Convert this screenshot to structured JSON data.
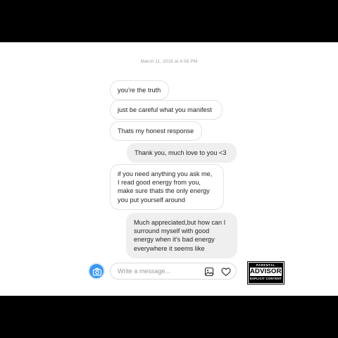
{
  "timestamp": "March 11, 2018 at 4:06 PM",
  "messages": [
    {
      "direction": "incoming",
      "text": "you’re the truth"
    },
    {
      "direction": "incoming",
      "text": "just be careful what you manifest"
    },
    {
      "direction": "incoming",
      "text": "Thats my honest response"
    },
    {
      "direction": "outgoing",
      "text": "Thank you, much love to you <3"
    },
    {
      "direction": "incoming",
      "text": "if you need anything you ask me,\nI read good energy from you,\nmake sure thats the only energy\nyou put yourself around"
    },
    {
      "direction": "outgoing",
      "text": "Much appreciated,but how can I\nsurround myself with good\nenergy when it’s bad energy\neverywhere it seems like"
    }
  ],
  "composer": {
    "placeholder": "Write a message...",
    "value": "",
    "camera_icon": "camera-icon",
    "gallery_icon": "image-icon",
    "like_icon": "heart-icon"
  },
  "advisory": {
    "line1": "PARENTAL",
    "line2": "ADVISORY",
    "line3": "EXPLICIT CONTENT"
  },
  "colors": {
    "background": "#ffffff",
    "letterbox": "#000000",
    "accent": "#3897f0",
    "outgoing_bubble": "#efefef",
    "bubble_border": "#e3e3e3",
    "text": "#262626"
  }
}
